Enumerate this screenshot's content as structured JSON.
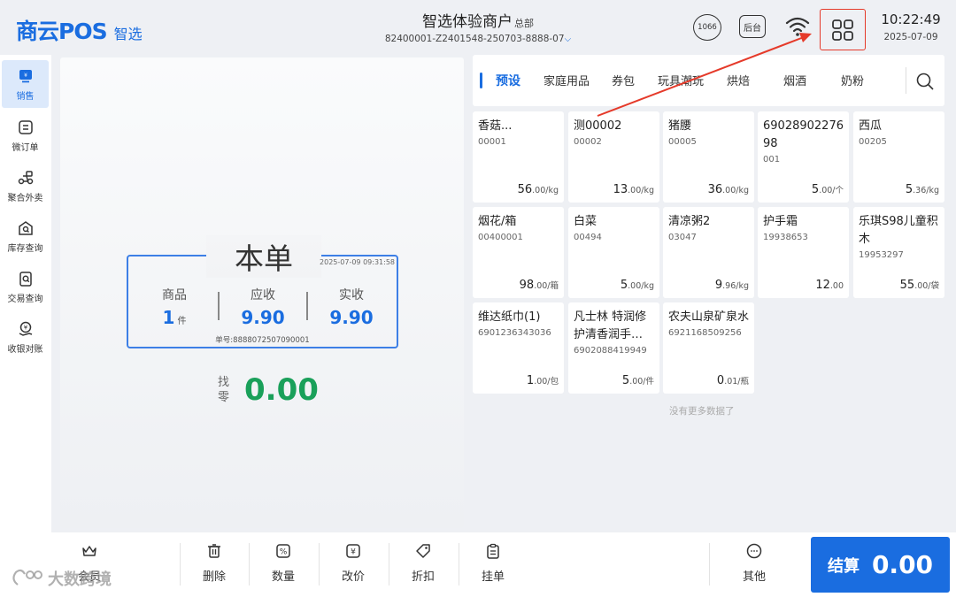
{
  "header": {
    "logo_main": "商云POS",
    "logo_sub": "智选",
    "merchant_name": "智选体验商户",
    "merchant_tag": "总部",
    "merchant_code": "82400001-Z2401548-250703-8888-07",
    "badge": "1066",
    "backend_label": "后台",
    "time": "10:22:49",
    "date": "2025-07-09"
  },
  "sidebar": {
    "items": [
      {
        "label": "销售",
        "icon": "sales-icon"
      },
      {
        "label": "微订单",
        "icon": "micro-order-icon"
      },
      {
        "label": "聚合外卖",
        "icon": "delivery-icon"
      },
      {
        "label": "库存查询",
        "icon": "inventory-icon"
      },
      {
        "label": "交易查询",
        "icon": "transaction-icon"
      },
      {
        "label": "收银对账",
        "icon": "reconcile-icon"
      }
    ]
  },
  "order": {
    "title": "本单",
    "time": "2025-07-09 09:31:58",
    "goods_label": "商品",
    "goods_count": "1",
    "goods_unit": "件",
    "due_label": "应收",
    "due_value": "9.90",
    "paid_label": "实收",
    "paid_value": "9.90",
    "order_no": "单号:8888072507090001",
    "change_label": "找零",
    "change_value": "0.00"
  },
  "categories": {
    "tabs": [
      "预设",
      "家庭用品",
      "券包",
      "玩具潮玩",
      "烘焙",
      "烟酒",
      "奶粉"
    ]
  },
  "products": [
    {
      "name": "香菇...",
      "code": "00001",
      "price": "56",
      "dec": ".00",
      "unit": "/kg"
    },
    {
      "name": "测00002",
      "code": "00002",
      "price": "13",
      "dec": ".00",
      "unit": "/kg"
    },
    {
      "name": "猪腰",
      "code": "00005",
      "price": "36",
      "dec": ".00",
      "unit": "/kg"
    },
    {
      "name": "6902890227698",
      "code": "001",
      "price": "5",
      "dec": ".00",
      "unit": "/个"
    },
    {
      "name": "西瓜",
      "code": "00205",
      "price": "5",
      "dec": ".36",
      "unit": "/kg"
    },
    {
      "name": "烟花/箱",
      "code": "00400001",
      "price": "98",
      "dec": ".00",
      "unit": "/箱"
    },
    {
      "name": "白菜",
      "code": "00494",
      "price": "5",
      "dec": ".00",
      "unit": "/kg"
    },
    {
      "name": "清凉粥2",
      "code": "03047",
      "price": "9",
      "dec": ".96",
      "unit": "/kg"
    },
    {
      "name": "护手霜",
      "code": "19938653",
      "price": "12",
      "dec": ".00",
      "unit": ""
    },
    {
      "name": "乐琪S98儿童积木",
      "code": "19953297",
      "price": "55",
      "dec": ".00",
      "unit": "/袋"
    },
    {
      "name": "维达纸巾(1)",
      "code": "6901236343036",
      "price": "1",
      "dec": ".00",
      "unit": "/包"
    },
    {
      "name": "凡士林 特润修护清香润手…",
      "code": "6902088419949",
      "price": "5",
      "dec": ".00",
      "unit": "/件"
    },
    {
      "name": "农夫山泉矿泉水",
      "code": "6921168509256",
      "price": "0",
      "dec": ".01",
      "unit": "/瓶"
    }
  ],
  "no_more": "没有更多数据了",
  "bottom": {
    "member": "会员",
    "delete": "删除",
    "quantity": "数量",
    "change_price": "改价",
    "discount": "折扣",
    "hold": "挂单",
    "other": "其他",
    "checkout_label": "结算",
    "checkout_value": "0.00"
  },
  "watermark": "大数跨境",
  "colors": {
    "accent": "#1a6de0",
    "change": "#1aa05a",
    "highlight": "#e53a2a"
  }
}
